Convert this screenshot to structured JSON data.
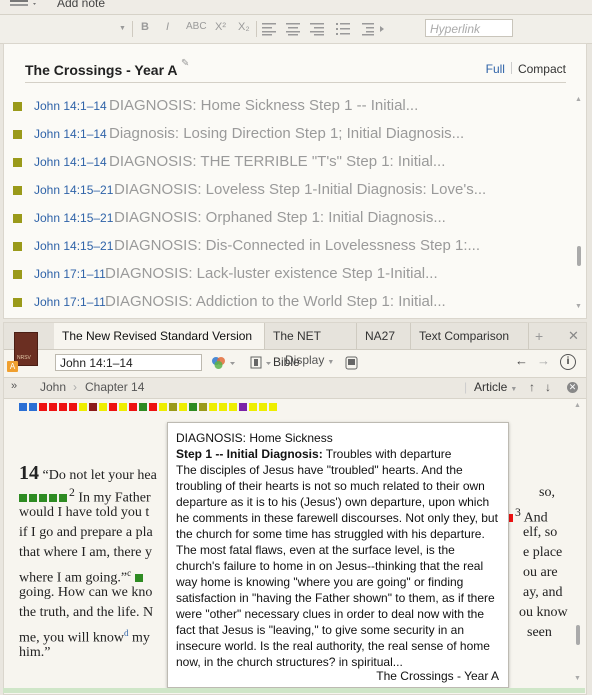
{
  "toolbar": {
    "add_note": "Add note",
    "bold": "B",
    "italic": "I",
    "abc": "ABC",
    "superscript": "X²",
    "subscript": "X₂",
    "hyperlink_placeholder": "Hyperlink"
  },
  "notes_panel": {
    "title": "The Crossings - Year A",
    "view_full": "Full",
    "view_compact": "Compact",
    "items": [
      {
        "ref": "John 14:1–14",
        "text": "DIAGNOSIS: Home Sickness Step 1 -- Initial..."
      },
      {
        "ref": "John 14:1–14",
        "text": "Diagnosis: Losing Direction Step 1; Initial Diagnosis..."
      },
      {
        "ref": "John 14:1–14",
        "text": "DIAGNOSIS: THE TERRIBLE \"T's\" Step 1: Initial..."
      },
      {
        "ref": "John 14:15–21",
        "text": "DIAGNOSIS: Loveless Step 1-Initial Diagnosis: Love's..."
      },
      {
        "ref": "John 14:15–21",
        "text": "DIAGNOSIS: Orphaned Step 1: Initial Diagnosis..."
      },
      {
        "ref": "John 14:15–21",
        "text": "DIAGNOSIS: Dis-Connected in Lovelessness Step 1:..."
      },
      {
        "ref": "John 17:1–11",
        "text": "DIAGNOSIS: Lack-luster existence Step 1-Initial..."
      },
      {
        "ref": "John 17:1–11",
        "text": "DIAGNOSIS: Addiction to the World Step 1: Initial..."
      }
    ]
  },
  "bible_panel": {
    "tabs": [
      "The New Revised Standard Version",
      "The NET Bible",
      "NA27",
      "Text Comparison"
    ],
    "book_label": "NRSV",
    "reference_value": "John 14:1–14",
    "display_label": "Display",
    "breadcrumb": [
      "John",
      "Chapter 14"
    ],
    "article_label": "Article",
    "scripture_lines": [
      {
        "chapter": "14",
        "text": "“Do not let your hea"
      },
      {
        "verse": "2",
        "text": "In my Father",
        "tail": "so,"
      },
      {
        "text": "would I have told you t",
        "verse_tail": "3",
        "tail": "And"
      },
      {
        "text": "if I go and prepare a pla",
        "tail": "elf, so"
      },
      {
        "text": "that where I am, there y",
        "tail": "e place"
      },
      {
        "text": "where I am going.”",
        "note": "c",
        "tail": "ou are"
      },
      {
        "text": "going. How can we kno",
        "tail": "ay, and"
      },
      {
        "text": "the truth, and the life. N",
        "tail": "ou know"
      },
      {
        "text": "me, you will know",
        "note": "d",
        "text2": "my",
        "tail": "seen"
      },
      {
        "text": "him.”"
      }
    ]
  },
  "popup": {
    "heading": "DIAGNOSIS: Home Sickness",
    "step_label": "Step 1 -- Initial Diagnosis:",
    "step_text": " Troubles with departure",
    "body": "The disciples of Jesus have \"troubled\" hearts. And the troubling of their hearts is not so much related to their own departure as it is to his (Jesus') own departure, upon which he comments in these farewell discourses. Not only they, but the church for some time has struggled with his departure. The most fatal flaws, even at the surface level, is the church's failure to home in on Jesus--thinking that the real way home is knowing \"where you are going\" or finding satisfaction in \"having the Father shown\" to them, as if there were \"other\" necessary clues in order to deal now with the fact that Jesus is \"leaving,\" to give some security in an insecure world. Is the real authority, the real sense of home now, in the church structures? in spiritual...",
    "source": "The Crossings - Year A"
  },
  "colors": {
    "link": "#2f63a8",
    "note_marker": "#9a9a1a",
    "highlight_green": "#2e8b22",
    "highlight_red": "#e11111",
    "highlight_yellow": "#eeee00"
  }
}
